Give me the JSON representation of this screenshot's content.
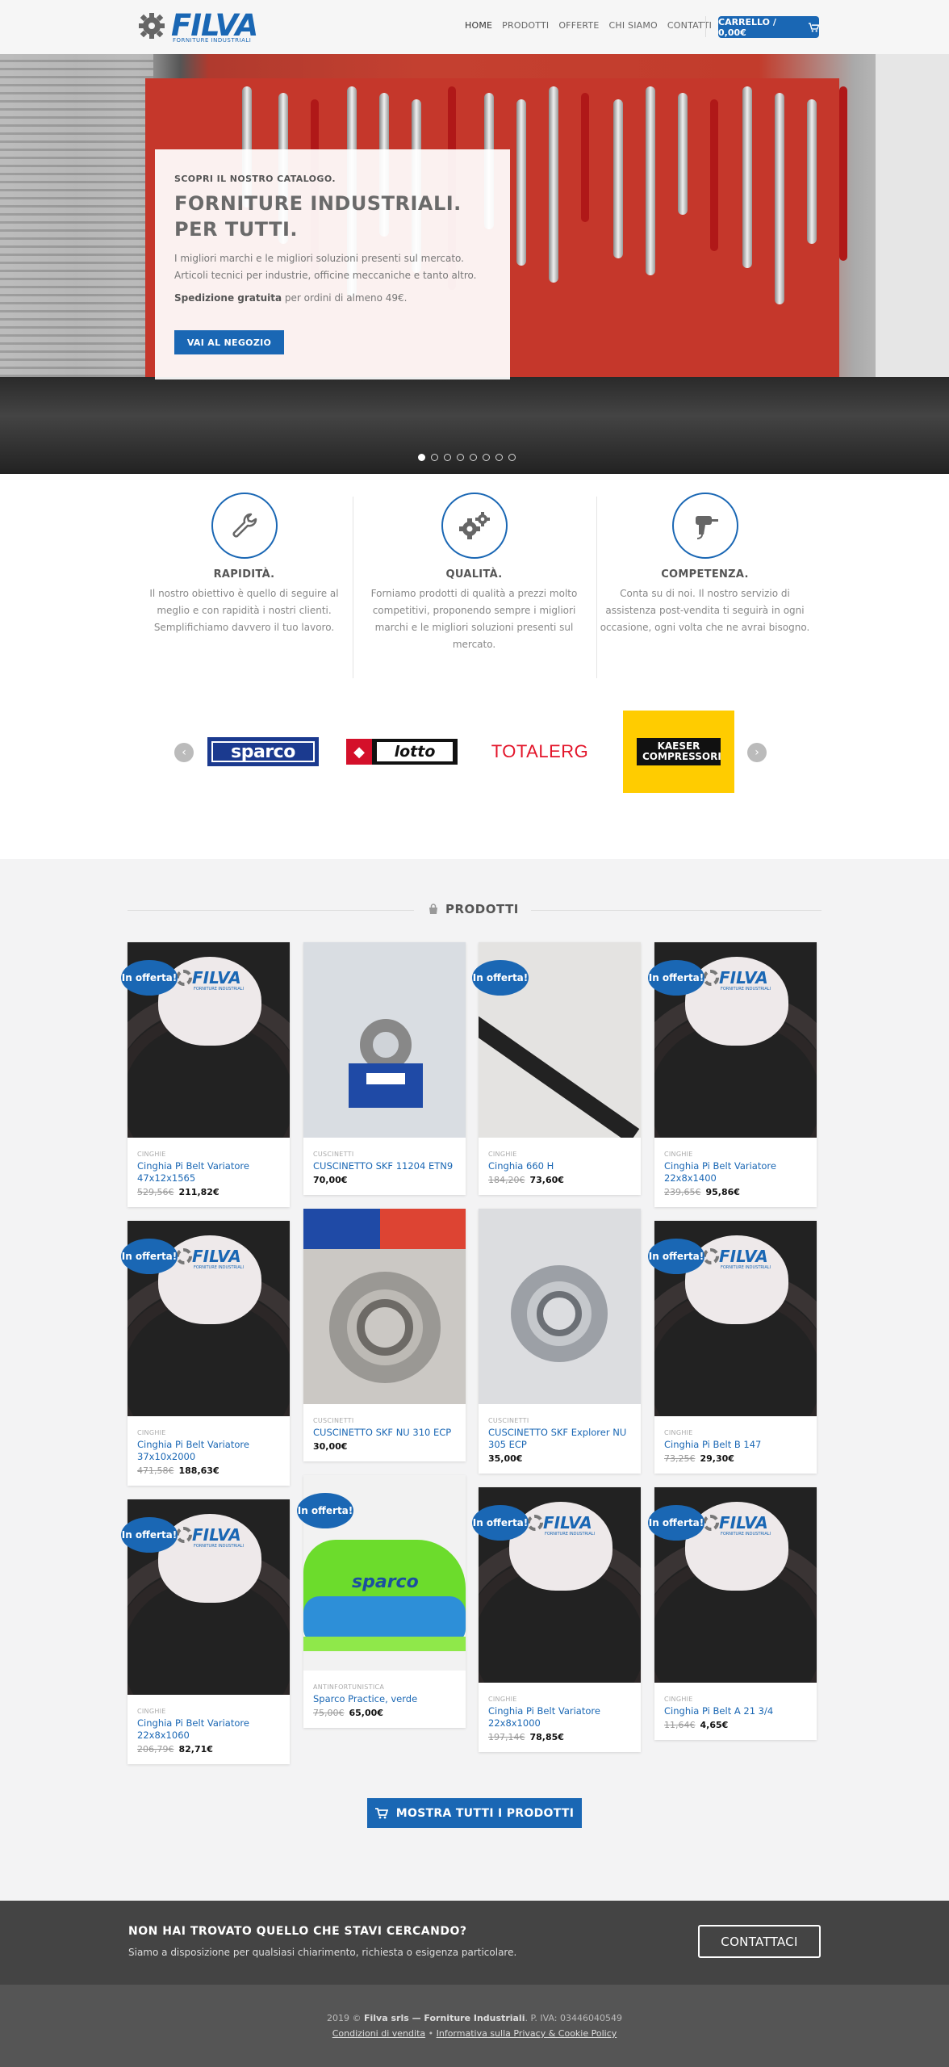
{
  "header": {
    "logo_text": "FILVA",
    "logo_sub": "FORNITURE INDUSTRIALI",
    "nav": [
      "HOME",
      "PRODOTTI",
      "OFFERTE",
      "CHI SIAMO",
      "CONTATTI"
    ],
    "cart_label": "CARRELLO / 0,00€",
    "accent": "#1a67b4"
  },
  "hero": {
    "eyebrow": "SCOPRI IL NOSTRO CATALOGO.",
    "title_line1": "FORNITURE INDUSTRIALI.",
    "title_line2": "PER TUTTI.",
    "desc_line1": "I migliori marchi e le migliori soluzioni presenti sul mercato.",
    "desc_line2": "Articoli tecnici per industrie, officine meccaniche e tanto altro.",
    "ship_bold": "Spedizione gratuita",
    "ship_rest": " per ordini di almeno 49€.",
    "button": "VAI AL NEGOZIO",
    "slides": 8,
    "active_slide": 1
  },
  "features": [
    {
      "icon": "wrench-icon",
      "title": "RAPIDITÀ.",
      "desc": "Il nostro obiettivo è quello di seguire al meglio e con rapidità i nostri clienti. Semplifichiamo davvero il tuo lavoro."
    },
    {
      "icon": "gears-icon",
      "title": "QUALITÀ.",
      "desc": "Forniamo prodotti di qualità a prezzi molto competitivi, proponendo sempre i migliori marchi e le migliori soluzioni presenti sul mercato."
    },
    {
      "icon": "drill-icon",
      "title": "COMPETENZA.",
      "desc": "Conta su di noi. Il nostro servizio di assistenza post-vendita ti seguirà in ogni occasione, ogni volta che ne avrai bisogno."
    }
  ],
  "brands": [
    "sparco",
    "lotto",
    "TOTALERG",
    "KAESER COMPRESSORI"
  ],
  "products_section": {
    "title": "PRODOTTI",
    "badge": "In offerta!",
    "items": [
      {
        "cat": "CINGHIE",
        "name": "Cinghia Pi Belt Variatore 47x12x1565",
        "old": "529,56€",
        "price": "211,82€",
        "img": "belt",
        "sale": true
      },
      {
        "cat": "CUSCINETTI",
        "name": "CUSCINETTO SKF 11204 ETN9",
        "old": "",
        "price": "70,00€",
        "img": "bearing",
        "sale": false
      },
      {
        "cat": "CINGHIE",
        "name": "Cinghia 660 H",
        "old": "184,20€",
        "price": "73,60€",
        "img": "belt2",
        "sale": true
      },
      {
        "cat": "CINGHIE",
        "name": "Cinghia Pi Belt Variatore 22x8x1400",
        "old": "239,65€",
        "price": "95,86€",
        "img": "belt",
        "sale": true
      },
      {
        "cat": "CINGHIE",
        "name": "Cinghia Pi Belt Variatore 37x10x2000",
        "old": "471,58€",
        "price": "188,63€",
        "img": "belt",
        "sale": true
      },
      {
        "cat": "CUSCINETTI",
        "name": "CUSCINETTO SKF NU 310 ECP",
        "old": "",
        "price": "30,00€",
        "img": "bearing2",
        "sale": false
      },
      {
        "cat": "CUSCINETTI",
        "name": "CUSCINETTO SKF Explorer NU 305 ECP",
        "old": "",
        "price": "35,00€",
        "img": "bearing3",
        "sale": false
      },
      {
        "cat": "CINGHIE",
        "name": "Cinghia Pi Belt B 147",
        "old": "73,25€",
        "price": "29,30€",
        "img": "belt",
        "sale": true
      },
      {
        "cat": "CINGHIE",
        "name": "Cinghia Pi Belt Variatore 22x8x1060",
        "old": "206,79€",
        "price": "82,71€",
        "img": "belt",
        "sale": true
      },
      {
        "cat": "ANTINFORTUNISTICA",
        "name": "Sparco Practice, verde",
        "old": "75,00€",
        "price": "65,00€",
        "img": "shoe",
        "sale": true
      },
      {
        "cat": "CINGHIE",
        "name": "Cinghia Pi Belt Variatore 22x8x1000",
        "old": "197,14€",
        "price": "78,85€",
        "img": "belt",
        "sale": true
      },
      {
        "cat": "CINGHIE",
        "name": "Cinghia Pi Belt A 21 3/4",
        "old": "11,64€",
        "price": "4,65€",
        "img": "belt",
        "sale": true
      }
    ],
    "show_all": "MOSTRA TUTTI I PRODOTTI"
  },
  "contact": {
    "heading": "NON HAI TROVATO QUELLO CHE STAVI CERCANDO?",
    "text": "Siamo a disposizione per qualsiasi chiarimento, richiesta o esigenza particolare.",
    "button": "CONTATTACI"
  },
  "footer": {
    "prefix": "2019 © ",
    "company": "Filva srls — Forniture Industriali",
    "vat": ". P. IVA: 03446040549",
    "link1": "Condizioni di vendita",
    "sep": " • ",
    "link2": "Informativa sulla Privacy & Cookie Policy"
  }
}
